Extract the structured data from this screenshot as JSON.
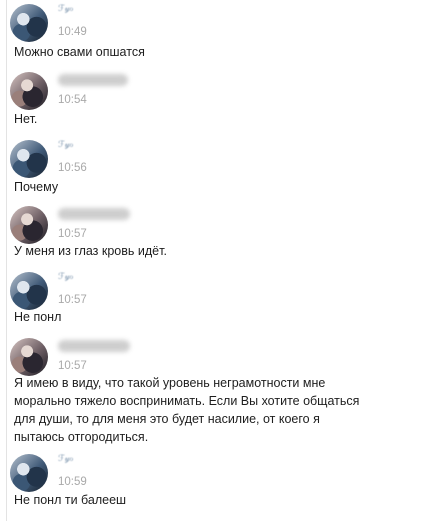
{
  "messages": [
    {
      "author": "other",
      "name_scribble": "ℱ𝓎ℴ",
      "time": "10:49",
      "text": "Можно свами опшатся"
    },
    {
      "author": "me",
      "time": "10:54",
      "text": "Нет."
    },
    {
      "author": "other",
      "name_scribble": "ℱ𝓎ℴ",
      "time": "10:56",
      "text": "Почему"
    },
    {
      "author": "me",
      "time": "10:57",
      "text": "У меня из глаз кровь идёт."
    },
    {
      "author": "other",
      "name_scribble": "ℱ𝓎ℴ",
      "time": "10:57",
      "text": "Не понл"
    },
    {
      "author": "me",
      "time": "10:57",
      "text": "Я имею в виду, что такой уровень неграмотности мне\nморально тяжело воспринимать. Если Вы хотите общаться\nдля души, то для меня это будет насилие, от коего я\nпытаюсь отгородиться."
    },
    {
      "author": "other",
      "name_scribble": "ℱ𝓎ℴ",
      "time": "10:59",
      "text": "Не понл ти балееш"
    }
  ]
}
